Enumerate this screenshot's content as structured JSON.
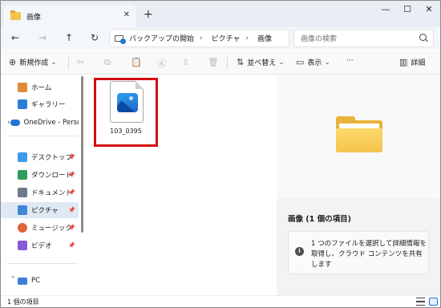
{
  "window": {
    "tab_title": "画像",
    "tab_close": "✕",
    "new_tab": "+",
    "minimize": "—",
    "maximize": "☐",
    "close": "✕"
  },
  "nav": {
    "back": "←",
    "forward": "→",
    "up": "↑",
    "refresh": "↻"
  },
  "breadcrumb": {
    "chevron": "›",
    "items": [
      "バックアップの開始",
      "ピクチャ",
      "画像"
    ]
  },
  "search": {
    "placeholder": "画像の検索"
  },
  "toolbar": {
    "new_label": "新規作成",
    "new_arrow": "⌄",
    "sort_label": "並べ替え",
    "view_label": "表示",
    "more_label": "···",
    "details_label": "詳細",
    "icons": {
      "new": "⊕",
      "cut": "✂",
      "copy": "⧉",
      "paste": "📋",
      "rename": "Ⓐ",
      "share": "⇪",
      "delete": "🗑",
      "sort": "⇅",
      "view": "▭",
      "details": "▥"
    }
  },
  "sidebar": {
    "expand_arrow": "›",
    "pin": "📌",
    "items": [
      {
        "label": "ホーム",
        "icon": "home-icon",
        "color": "#e38a39"
      },
      {
        "label": "ギャラリー",
        "icon": "gallery-icon",
        "color": "#2a7cd6"
      },
      {
        "label": "OneDrive - Perso",
        "icon": "onedrive-icon",
        "color": "#1f74d0"
      },
      {
        "label": "デスクトップ",
        "icon": "desktop-icon",
        "color": "#3d9be9"
      },
      {
        "label": "ダウンロード",
        "icon": "download-icon",
        "color": "#2f9a5a"
      },
      {
        "label": "ドキュメント",
        "icon": "documents-icon",
        "color": "#6b7b8c"
      },
      {
        "label": "ピクチャ",
        "icon": "pictures-icon",
        "color": "#3f86d9"
      },
      {
        "label": "ミュージック",
        "icon": "music-icon",
        "color": "#e0643a"
      },
      {
        "label": "ビデオ",
        "icon": "videos-icon",
        "color": "#8a5ad6"
      },
      {
        "label": "PC",
        "icon": "pc-icon",
        "color": "#3d7dd8"
      }
    ]
  },
  "file": {
    "name": "103_0395",
    "icon": "image-file-icon"
  },
  "details_pane": {
    "title": "画像 (1 個の項目)",
    "info_icon": "i",
    "info_text": "1 つのファイルを選択して詳細情報を取得し、クラウド コンテンツを共有します"
  },
  "status": {
    "item_count": "1 個の項目"
  },
  "colors": {
    "accent": "#1f6fd1",
    "highlight_box": "#d60d0d",
    "folder": "#f4c44e"
  }
}
